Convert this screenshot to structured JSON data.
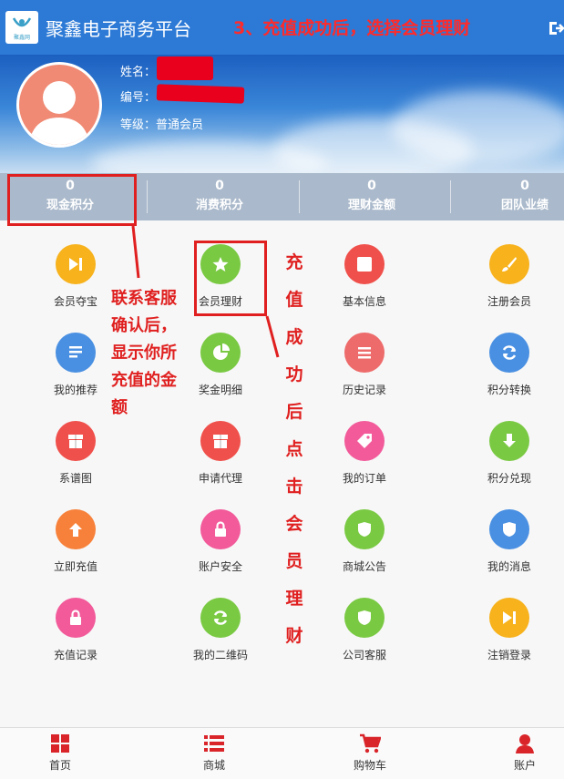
{
  "header": {
    "app_title": "聚鑫电子商务平台",
    "step_note": "3、充值成功后，选择会员理财",
    "logo_text": "聚鑫网"
  },
  "profile": {
    "name_label": "姓名：",
    "id_label": "编号：",
    "level_label": "等级：",
    "level_value": "普通会员"
  },
  "stats": [
    {
      "value": "0",
      "label": "现金积分"
    },
    {
      "value": "0",
      "label": "消费积分"
    },
    {
      "value": "0",
      "label": "理财金额"
    },
    {
      "value": "0",
      "label": "团队业绩"
    }
  ],
  "grid": [
    {
      "label": "会员夺宝",
      "icon": "skip-next-icon",
      "color": "#f7b21c"
    },
    {
      "label": "会员理财",
      "icon": "star-icon",
      "color": "#7ac943"
    },
    {
      "label": "基本信息",
      "icon": "square-icon",
      "color": "#f0504b"
    },
    {
      "label": "注册会员",
      "icon": "brush-icon",
      "color": "#f7b21c"
    },
    {
      "label": "我的推荐",
      "icon": "list-icon",
      "color": "#4a90e2"
    },
    {
      "label": "奖金明细",
      "icon": "pie-chart-icon",
      "color": "#7ac943"
    },
    {
      "label": "历史记录",
      "icon": "stack-icon",
      "color": "#ee6b6b"
    },
    {
      "label": "积分转换",
      "icon": "refresh-icon",
      "color": "#4a90e2"
    },
    {
      "label": "系谱图",
      "icon": "box-icon",
      "color": "#f0504b"
    },
    {
      "label": "申请代理",
      "icon": "box-icon",
      "color": "#f0504b"
    },
    {
      "label": "我的订单",
      "icon": "tag-icon",
      "color": "#f25a9a"
    },
    {
      "label": "积分兑现",
      "icon": "download-icon",
      "color": "#7ac943"
    },
    {
      "label": "立即充值",
      "icon": "upload-icon",
      "color": "#f7813a"
    },
    {
      "label": "账户安全",
      "icon": "lock-icon",
      "color": "#f25a9a"
    },
    {
      "label": "商城公告",
      "icon": "shield-icon",
      "color": "#7ac943"
    },
    {
      "label": "我的消息",
      "icon": "shield-icon",
      "color": "#4a90e2"
    },
    {
      "label": "充值记录",
      "icon": "lock-icon",
      "color": "#f25a9a"
    },
    {
      "label": "我的二维码",
      "icon": "refresh-icon",
      "color": "#7ac943"
    },
    {
      "label": "公司客服",
      "icon": "shield-icon",
      "color": "#7ac943"
    },
    {
      "label": "注销登录",
      "icon": "skip-next-icon",
      "color": "#f7b21c"
    }
  ],
  "annotations": {
    "left_note": [
      "联系客服",
      "确认后，",
      "显示你所",
      "充值的金",
      "额"
    ],
    "vertical_note": "充值成功后点击会员理财"
  },
  "nav": [
    {
      "label": "首页",
      "icon": "grid-icon"
    },
    {
      "label": "商城",
      "icon": "list-icon"
    },
    {
      "label": "购物车",
      "icon": "cart-icon"
    },
    {
      "label": "账户",
      "icon": "user-icon"
    }
  ]
}
